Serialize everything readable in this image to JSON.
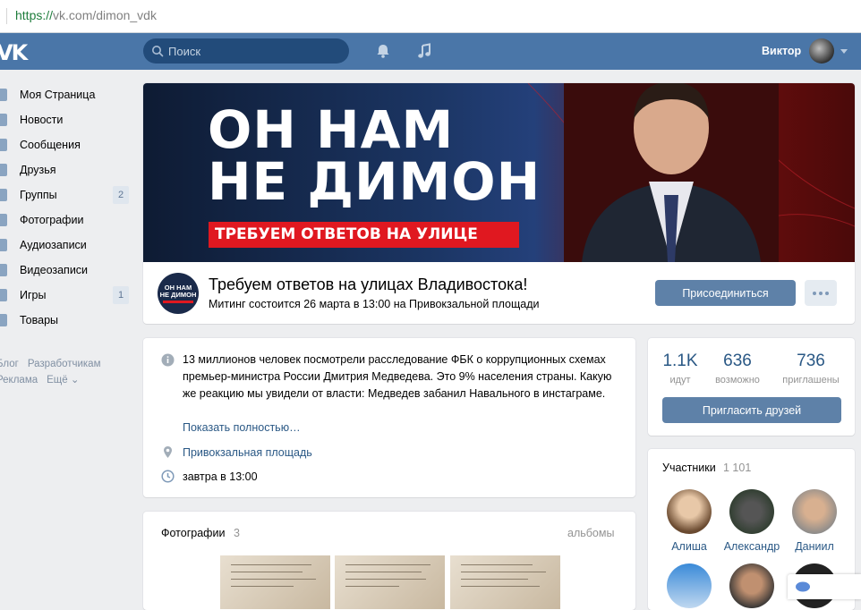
{
  "browser": {
    "url_scheme": "https://",
    "url_rest": "vk.com/dimon_vdk"
  },
  "header": {
    "logo": "VK",
    "search_placeholder": "Поиск",
    "user_name": "Виктор"
  },
  "sidebar": {
    "items": [
      {
        "label": "Моя Страница",
        "count": ""
      },
      {
        "label": "Новости",
        "count": ""
      },
      {
        "label": "Сообщения",
        "count": ""
      },
      {
        "label": "Друзья",
        "count": ""
      },
      {
        "label": "Группы",
        "count": "2"
      },
      {
        "label": "Фотографии",
        "count": ""
      },
      {
        "label": "Аудиозаписи",
        "count": ""
      },
      {
        "label": "Видеозаписи",
        "count": ""
      },
      {
        "label": "Игры",
        "count": "1"
      },
      {
        "label": "Товары",
        "count": ""
      }
    ],
    "footer": [
      "Блог",
      "Разработчикам",
      "Реклама",
      "Ещё ⌄"
    ]
  },
  "cover": {
    "line1": "ОН НАМ",
    "line2": "НЕ ДИМОН",
    "banner": "ТРЕБУЕМ ОТВЕТОВ НА УЛИЦЕ",
    "avatar_text": "ОН НАМ НЕ ДИМОН"
  },
  "group": {
    "title": "Требуем ответов на улицах Владивостока!",
    "status": "Митинг состоится 26 марта в 13:00 на Привокзальной площади",
    "join_label": "Присоединиться"
  },
  "info": {
    "description": "13 миллионов человек посмотрели расследование ФБК о коррупционных схемах премьер-министра России Дмитрия Медведева. Это 9% населения страны. Какую же реакцию мы увидели от власти: Медведев забанил Навального в инстаграме.",
    "show_more": "Показать полностью…",
    "place": "Привокзальная площадь",
    "time": "завтра в 13:00"
  },
  "photos": {
    "title": "Фотографии",
    "count": "3",
    "albums": "альбомы"
  },
  "stats": [
    {
      "value": "1.1K",
      "label": "идут"
    },
    {
      "value": "636",
      "label": "возможно"
    },
    {
      "value": "736",
      "label": "приглашены"
    }
  ],
  "invite_label": "Пригласить друзей",
  "members": {
    "title": "Участники",
    "count": "1 101",
    "list": [
      {
        "name": "Алиша"
      },
      {
        "name": "Александр"
      },
      {
        "name": "Даниил"
      }
    ]
  }
}
